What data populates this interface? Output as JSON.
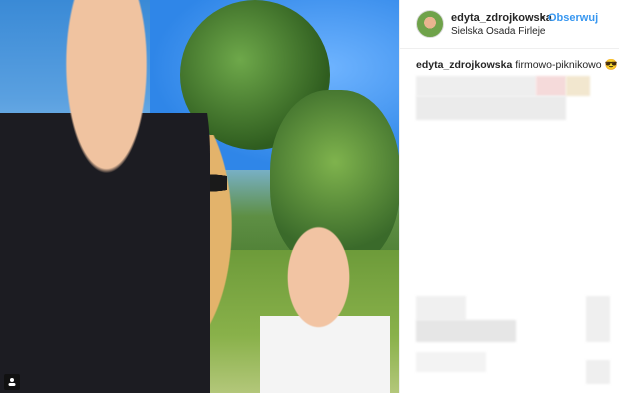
{
  "post": {
    "username": "edyta_zdrojkowska",
    "separator": "•",
    "follow_label": "Obserwuj",
    "location": "Sielska Osada Firleje",
    "caption_username": "edyta_zdrojkowska",
    "caption_text": "firmowo-piknikowo",
    "caption_emoji": "😎"
  },
  "icons": {
    "photo_corner": "user-tag-icon",
    "caption_emoji": "sunglasses-emoji"
  },
  "colors": {
    "link": "#3897f0",
    "text": "#262626",
    "border": "#efefef"
  }
}
